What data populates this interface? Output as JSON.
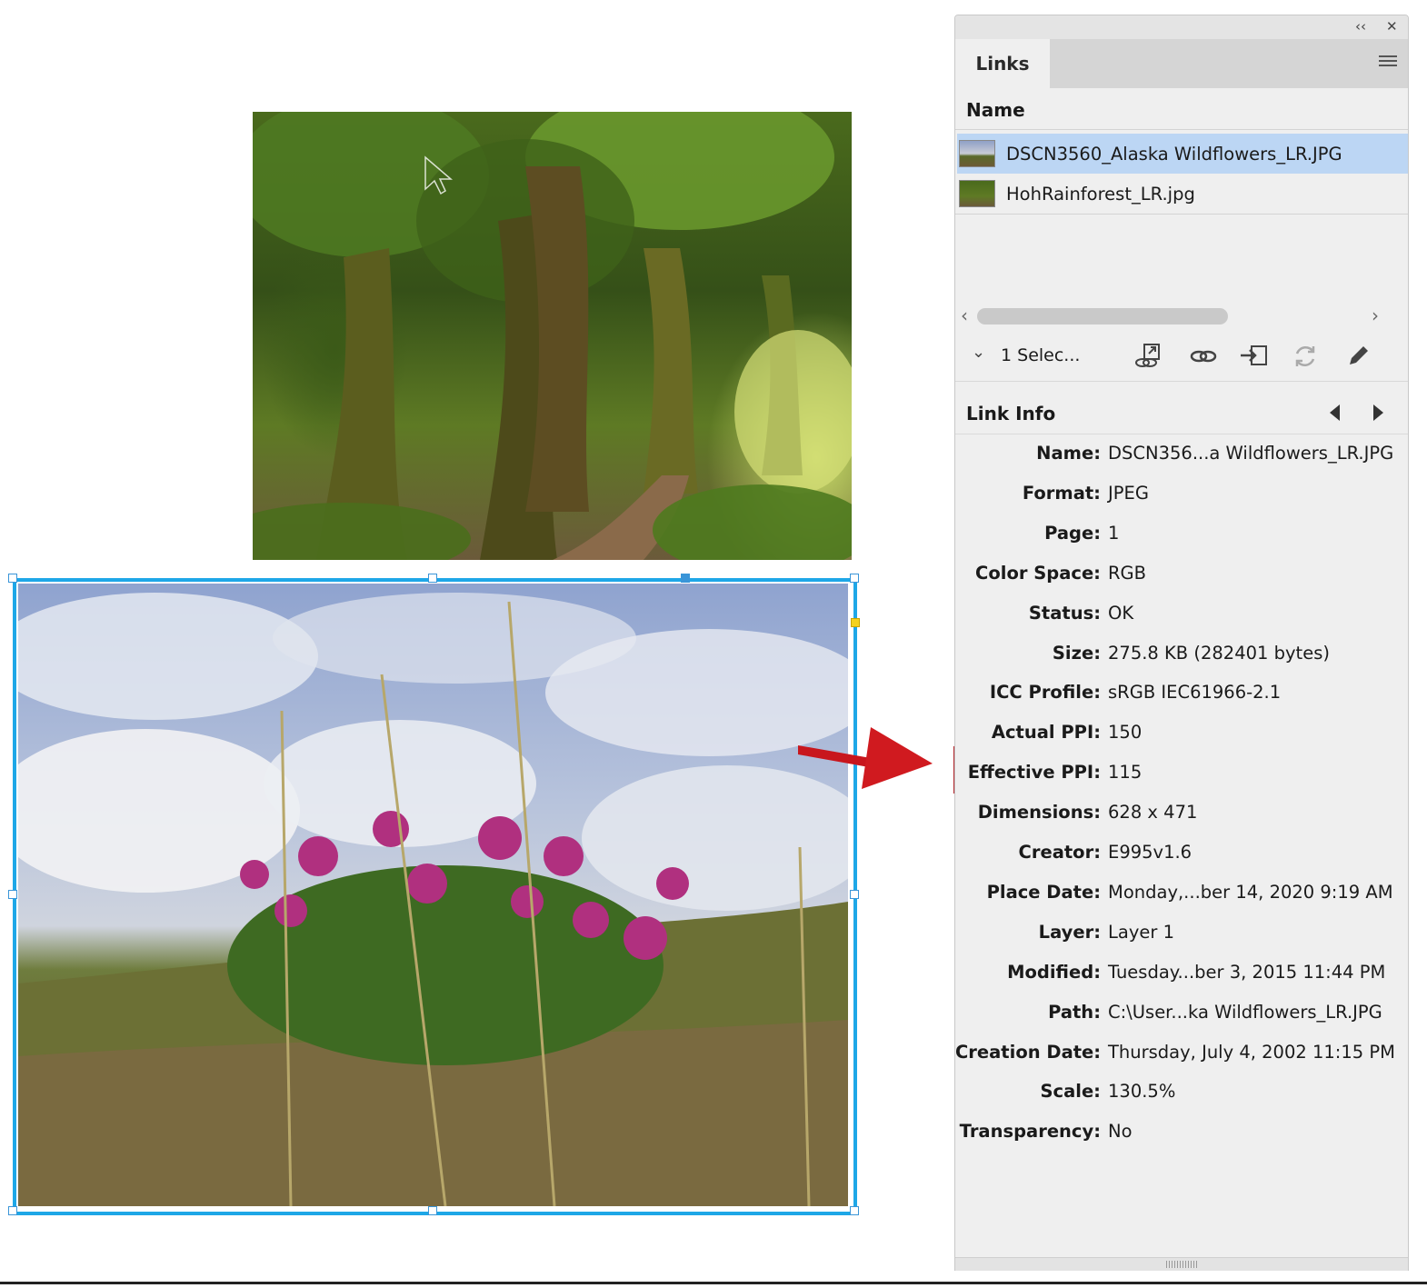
{
  "panel": {
    "tab_label": "Links",
    "column_header": "Name",
    "links": [
      {
        "name": "DSCN3560_Alaska Wildflowers_LR.JPG",
        "selected": true
      },
      {
        "name": "HohRainforest_LR.jpg",
        "selected": false
      }
    ],
    "selection_status": "1 Selec...",
    "toolbar_icons": [
      "relink-to-folder-icon",
      "go-to-link-icon",
      "embed-link-icon",
      "update-link-icon",
      "edit-original-icon"
    ]
  },
  "link_info": {
    "title": "Link Info",
    "fields": [
      {
        "label": "Name:",
        "value": "DSCN356...a Wildflowers_LR.JPG"
      },
      {
        "label": "Format:",
        "value": "JPEG"
      },
      {
        "label": "Page:",
        "value": "1"
      },
      {
        "label": "Color Space:",
        "value": "RGB"
      },
      {
        "label": "Status:",
        "value": "OK"
      },
      {
        "label": "Size:",
        "value": "275.8 KB (282401 bytes)"
      },
      {
        "label": "ICC Profile:",
        "value": "sRGB IEC61966-2.1"
      },
      {
        "label": "Actual PPI:",
        "value": "150"
      },
      {
        "label": "Effective PPI:",
        "value": "115"
      },
      {
        "label": "Dimensions:",
        "value": "628 x 471"
      },
      {
        "label": "Creator:",
        "value": "E995v1.6"
      },
      {
        "label": "Place Date:",
        "value": "Monday,...ber 14, 2020 9:19 AM"
      },
      {
        "label": "Layer:",
        "value": "Layer 1"
      },
      {
        "label": "Modified:",
        "value": "Tuesday...ber 3, 2015 11:44 PM"
      },
      {
        "label": "Path:",
        "value": "C:\\User...ka Wildflowers_LR.JPG"
      },
      {
        "label": "Creation Date:",
        "value": "Thursday, July 4, 2002 11:15 PM"
      },
      {
        "label": "Scale:",
        "value": "130.5%"
      },
      {
        "label": "Transparency:",
        "value": "No"
      }
    ]
  },
  "colors": {
    "selection_frame": "#1ea7e7",
    "annotation_red": "#c8161d",
    "row_selected": "#bcd6f4"
  }
}
